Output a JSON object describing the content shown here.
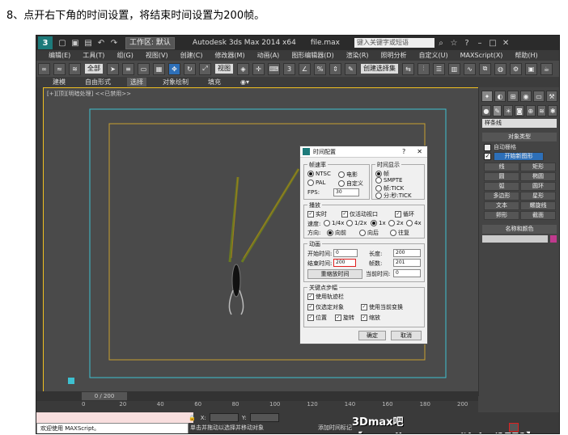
{
  "caption": "8、点开右下角的时间设置，将结束时间设置为200帧。",
  "app": {
    "workspace": "工作区: 默认",
    "title": "Autodesk 3ds Max  2014 x64",
    "filename": "file.max",
    "search_placeholder": "键入关键字或短语",
    "menu": [
      "编辑(E)",
      "工具(T)",
      "组(G)",
      "视图(V)",
      "创建(C)",
      "修改器(M)",
      "动画(A)",
      "图形编辑器(D)",
      "渲染(R)",
      "照明分析",
      "自定义(U)",
      "MAXScript(X)",
      "帮助(H)"
    ],
    "toolbar": {
      "filter": "全部",
      "view": "视图",
      "named_sel": "创建选择集"
    },
    "ribbon": [
      "建模",
      "自由形式",
      "选择",
      "对象绘制",
      "填充"
    ],
    "viewport_label": "[+][顶][明暗处理] <<已禁用>>",
    "right_panel": {
      "dropdown": "样条线",
      "object_type_header": "对象类型",
      "auto_grid": "自动栅格",
      "start_new_shape": "开始新图形",
      "buttons": [
        "线",
        "矩形",
        "圆",
        "椭圆",
        "弧",
        "圆环",
        "多边形",
        "星形",
        "文本",
        "螺旋线",
        "卵形",
        "截面"
      ],
      "name_color_header": "名称和颜色",
      "accent_color": "#c03a8e"
    },
    "time_slider": "0 / 200",
    "ticks": [
      "0",
      "20",
      "40",
      "60",
      "80",
      "100",
      "120",
      "140",
      "160",
      "180",
      "200"
    ],
    "status": {
      "welcome": "欢迎使用 MAXScript。",
      "message": "单击并拖动以选择并移动对象",
      "add_time_tag": "添加时间标记",
      "x_label": "X:",
      "y_label": "Y:"
    },
    "watermark": "3Dmax吧 【www.linecg.com/tieba/1771】"
  },
  "dialog": {
    "title": "时间配置",
    "help": "?",
    "close": "✕",
    "frame_rate": {
      "label": "帧速率",
      "options": [
        "NTSC",
        "电影",
        "PAL",
        "自定义"
      ],
      "fps_label": "FPS:",
      "fps_value": "30"
    },
    "time_display": {
      "label": "时间显示",
      "options": [
        "帧",
        "SMPTE",
        "帧:TICK",
        "分:秒:TICK"
      ]
    },
    "playback": {
      "label": "播放",
      "realtime": "实时",
      "active_viewport": "仅活动视口",
      "loop": "循环",
      "speed_label": "速度:",
      "speeds": [
        "1/4x",
        "1/2x",
        "1x",
        "2x",
        "4x"
      ],
      "direction_label": "方向:",
      "directions": [
        "向前",
        "向后",
        "往复"
      ]
    },
    "animation": {
      "label": "动画",
      "start_label": "开始时间:",
      "start_value": "0",
      "length_label": "长度:",
      "length_value": "200",
      "end_label": "结束时间:",
      "end_value": "200",
      "frames_label": "帧数:",
      "frames_value": "201",
      "rescale": "重缩放时间",
      "current_label": "当前时间:",
      "current_value": "0"
    },
    "key_steps": {
      "label": "关键点步幅",
      "use_track_bar": "使用轨迹栏",
      "selected_only": "仅选定对象",
      "use_current_transform": "使用当前变换",
      "position": "位置",
      "rotation": "旋转",
      "scale": "缩放"
    },
    "ok": "确定",
    "cancel": "取消"
  }
}
